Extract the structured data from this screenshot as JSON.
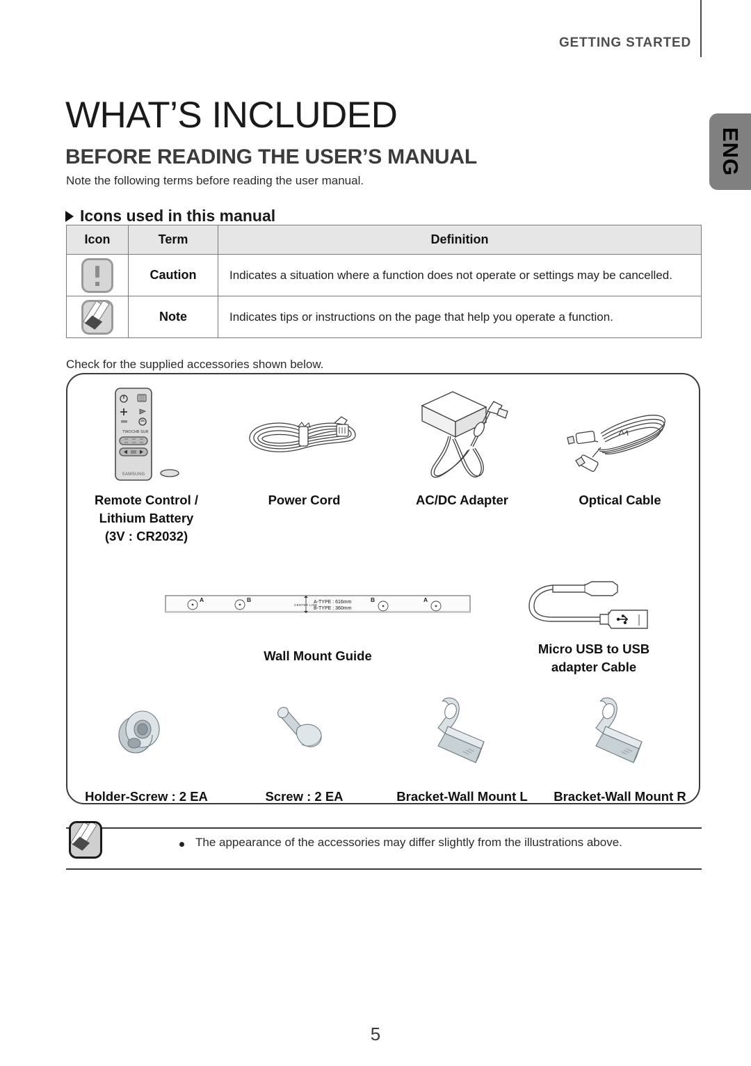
{
  "header": {
    "section_label": "GETTING STARTED",
    "lang_tab": "ENG"
  },
  "titles": {
    "page_title": "WHAT’S INCLUDED",
    "section_title": "BEFORE READING THE USER’S MANUAL",
    "intro_text": "Note the following terms before reading the user manual.",
    "subsection_heading": "Icons used in this manual"
  },
  "icon_table": {
    "headers": [
      "Icon",
      "Term",
      "Definition"
    ],
    "rows": [
      {
        "icon": "caution-icon",
        "term": "Caution",
        "definition": "Indicates a situation where a function does not operate or settings may be cancelled."
      },
      {
        "icon": "note-icon",
        "term": "Note",
        "definition": "Indicates tips or instructions on the page that help you operate a function."
      }
    ]
  },
  "check_text": "Check for the supplied accessories shown below.",
  "accessories": {
    "row1": [
      {
        "label_lines": [
          "Remote Control /",
          "Lithium Battery",
          "(3V : CR2032)"
        ],
        "art": "remote-control-battery-illustration"
      },
      {
        "label_lines": [
          "Power Cord"
        ],
        "art": "power-cord-illustration"
      },
      {
        "label_lines": [
          "AC/DC Adapter"
        ],
        "art": "ac-dc-adapter-illustration"
      },
      {
        "label_lines": [
          "Optical Cable"
        ],
        "art": "optical-cable-illustration"
      }
    ],
    "wall_guide": {
      "label": "Wall Mount Guide",
      "marks": [
        "A",
        "B",
        "B",
        "A"
      ],
      "center_line_text": "CENTER LINE",
      "dimension_lines": [
        "A-TYPE : 616mm",
        "B-TYPE : 360mm"
      ]
    },
    "usb_cable": {
      "label_lines": [
        "Micro USB to USB",
        "adapter Cable"
      ],
      "art": "micro-usb-to-usb-cable-illustration"
    },
    "row3": [
      {
        "label_lines": [
          "Holder-Screw : 2 EA"
        ],
        "art": "holder-screw-illustration"
      },
      {
        "label_lines": [
          "Screw : 2 EA"
        ],
        "art": "screw-illustration"
      },
      {
        "label_lines": [
          "Bracket-Wall Mount L"
        ],
        "art": "bracket-wall-mount-left-illustration"
      },
      {
        "label_lines": [
          "Bracket-Wall Mount R"
        ],
        "art": "bracket-wall-mount-right-illustration"
      }
    ]
  },
  "bottom_note": {
    "text": "The appearance of the accessories may differ slightly from the illustrations above."
  },
  "page_number": "5",
  "colors": {
    "accent_gray": "#808080",
    "table_header_bg": "#e6e6e6",
    "rule": "#3b3b3b",
    "text": "#1a1a1a"
  },
  "remote": {
    "brand": "SAMSUNG"
  }
}
